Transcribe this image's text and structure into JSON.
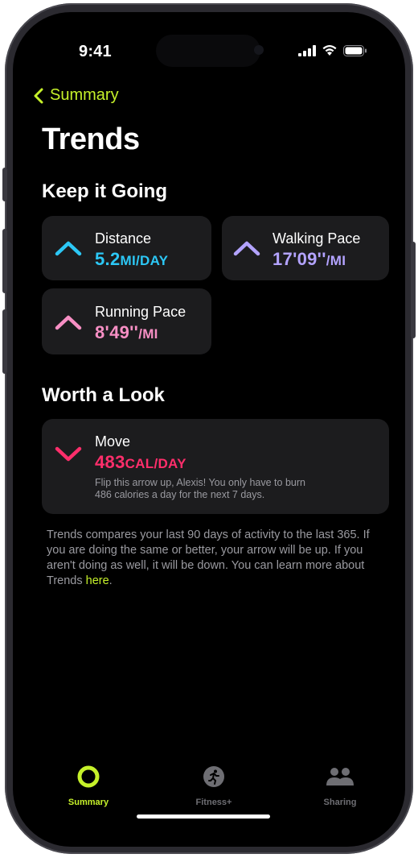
{
  "status": {
    "time": "9:41"
  },
  "nav": {
    "back_label": "Summary"
  },
  "page": {
    "title": "Trends"
  },
  "sections": {
    "keep_going": "Keep it Going",
    "worth_look": "Worth a Look"
  },
  "trends": {
    "distance": {
      "label": "Distance",
      "value": "5.2",
      "unit": "MI/DAY",
      "color": "#2cc7f5"
    },
    "walking": {
      "label": "Walking Pace",
      "value": "17'09''",
      "unit": "/MI",
      "color": "#b3a3ff"
    },
    "running": {
      "label": "Running Pace",
      "value": "8'49''",
      "unit": "/MI",
      "color": "#f78fc4"
    },
    "move": {
      "label": "Move",
      "value": "483",
      "unit": "CAL/DAY",
      "color": "#ff2e6b",
      "desc_line1": "Flip this arrow up, Alexis! You only have to burn",
      "desc_line2": "486 calories a day for the next 7 days."
    }
  },
  "footnote": {
    "text": "Trends compares your last 90 days of activity to the last 365. If you are doing the same or better, your arrow will be up. If you aren't doing as well, it will be down. You can learn more about Trends ",
    "link": "here",
    "end": "."
  },
  "tabs": {
    "summary": "Summary",
    "fitness": "Fitness+",
    "sharing": "Sharing"
  },
  "colors": {
    "accent": "#c6f12a",
    "tab_inactive": "#6e6e73"
  }
}
